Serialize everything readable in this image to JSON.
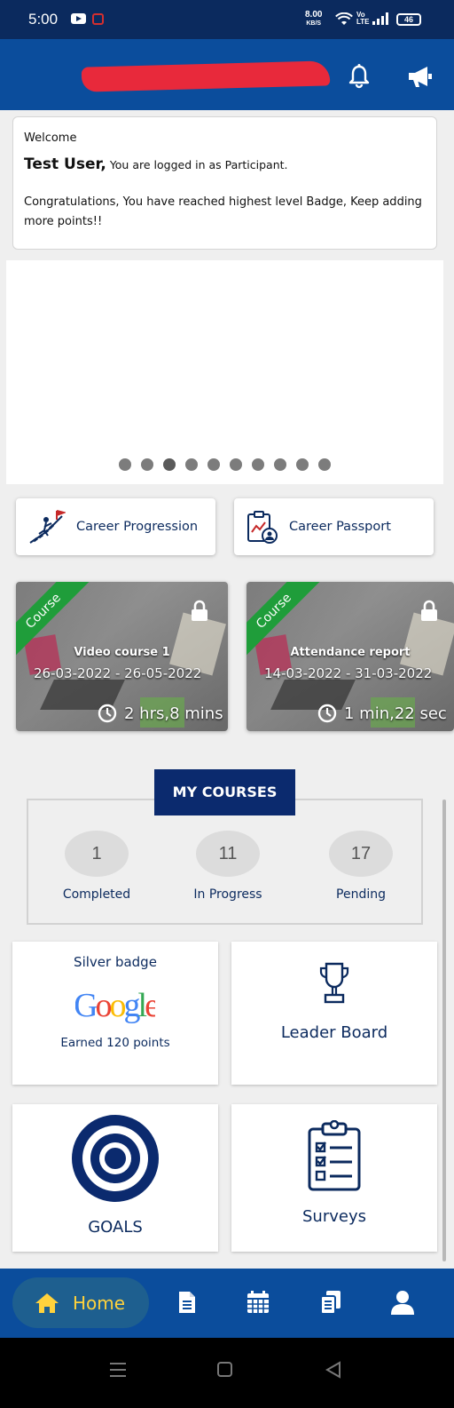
{
  "status_bar": {
    "time": "5:00",
    "speed_value": "8.00",
    "speed_unit": "KB/S",
    "volte_top": "Vo",
    "volte_bottom": "LTE",
    "battery": "46"
  },
  "header": {
    "username_redacted": "",
    "icons": [
      "bell-icon",
      "megaphone-icon"
    ]
  },
  "welcome": {
    "greeting": "Welcome",
    "user_name": "Test User,",
    "role_text": "You are logged in as Participant.",
    "message": "Congratulations, You have reached highest level Badge, Keep adding more points!!"
  },
  "banner": {
    "dot_count": 10,
    "active_index": 2
  },
  "career_buttons": [
    {
      "label": "Career Progression",
      "icon": "career-progression-icon"
    },
    {
      "label": "Career Passport",
      "icon": "career-passport-icon"
    }
  ],
  "courses": [
    {
      "tag": "Course",
      "title": "Video course 1",
      "dates": "26-03-2022 - 26-05-2022",
      "duration": "2 hrs,8 mins"
    },
    {
      "tag": "Course",
      "title": "Attendance report",
      "dates": "14-03-2022 - 31-03-2022",
      "duration": "1 min,22 sec"
    }
  ],
  "my_courses": {
    "heading": "MY COURSES",
    "stats": [
      {
        "value": "1",
        "label": "Completed"
      },
      {
        "value": "11",
        "label": "In Progress"
      },
      {
        "value": "17",
        "label": "Pending"
      }
    ]
  },
  "tiles": {
    "badge": {
      "title": "Silver badge",
      "logo_text": "Google",
      "points": "Earned 120 points"
    },
    "leaderboard": {
      "label": "Leader Board"
    },
    "goals": {
      "label": "GOALS"
    },
    "surveys": {
      "label": "Surveys"
    }
  },
  "bottom_nav": {
    "home_label": "Home",
    "items": [
      "home-icon",
      "document-icon",
      "calendar-icon",
      "copy-icon",
      "user-icon"
    ]
  },
  "colors": {
    "primary_dark": "#0b2a5e",
    "header_blue": "#0b4d9c",
    "home_accent": "#ffd23c",
    "ribbon_green": "#1f9d3a"
  }
}
